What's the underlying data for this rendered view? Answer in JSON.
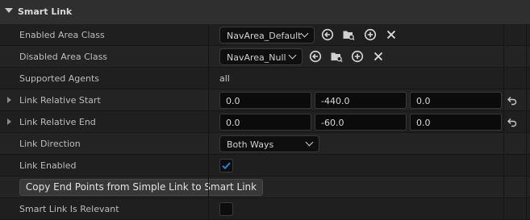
{
  "section": {
    "title": "Smart Link"
  },
  "rows": {
    "enabled_area_class": {
      "label": "Enabled Area Class",
      "value": "NavArea_Default"
    },
    "disabled_area_class": {
      "label": "Disabled Area Class",
      "value": "NavArea_Null"
    },
    "supported_agents": {
      "label": "Supported Agents",
      "value": "all"
    },
    "link_relative_start": {
      "label": "Link Relative Start",
      "x": "0.0",
      "y": "-440.0",
      "z": "0.0"
    },
    "link_relative_end": {
      "label": "Link Relative End",
      "x": "0.0",
      "y": "-60.0",
      "z": "0.0"
    },
    "link_direction": {
      "label": "Link Direction",
      "value": "Both Ways"
    },
    "link_enabled": {
      "label": "Link Enabled",
      "checked": true
    },
    "copy_button": {
      "label": "Copy End Points from Simple Link to Smart Link"
    },
    "smart_link_relevant": {
      "label": "Smart Link Is Relevant",
      "checked": false
    }
  },
  "icons": {
    "use_selected": "arrow-left-circle-icon",
    "browse": "folder-search-icon",
    "add": "plus-circle-icon",
    "clear": "close-icon",
    "reset": "reset-to-default-icon"
  },
  "colors": {
    "check": "#2d7fd6",
    "panel": "#1f1f1f",
    "header": "#2f2f2f"
  }
}
